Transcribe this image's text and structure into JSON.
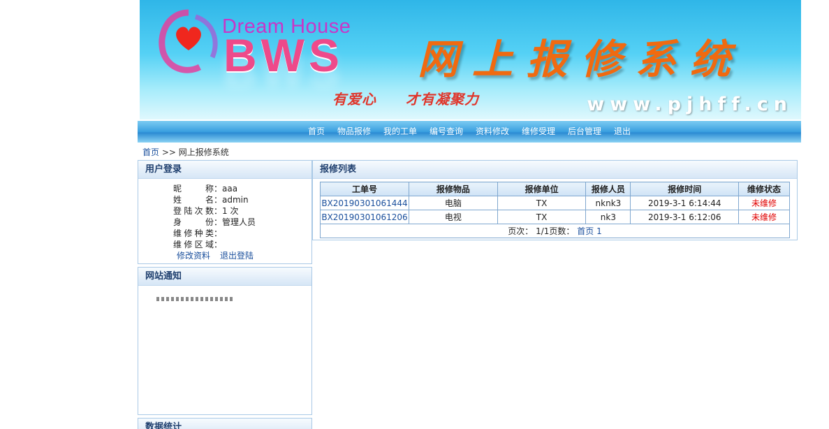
{
  "banner": {
    "brand_subtitle": "Dream House",
    "brand_main": "BWS",
    "system_title": "网上报修系统",
    "slogan": "有爱心 才有凝聚力",
    "site_url": "www.pjhff.cn"
  },
  "nav": {
    "items": [
      "首页",
      "物品报修",
      "我的工单",
      "编号查询",
      "资料修改",
      "维修受理",
      "后台管理",
      "退出"
    ]
  },
  "breadcrumb": {
    "home": "首页",
    "separator": ">>",
    "current": "网上报修系统"
  },
  "login_panel": {
    "title": "用户登录",
    "fields": [
      {
        "label": "昵称",
        "value": "aaa"
      },
      {
        "label": "姓名",
        "value": "admin"
      },
      {
        "label": "登陆次数",
        "value": "1 次"
      },
      {
        "label": "身份",
        "value": "管理人员"
      },
      {
        "label": "维修种类",
        "value": ""
      },
      {
        "label": "维修区域",
        "value": ""
      }
    ],
    "link_edit": "修改资料",
    "link_logout": "退出登陆"
  },
  "notice_panel": {
    "title": "网站通知"
  },
  "stats_panel": {
    "title": "数据统计"
  },
  "repair_list": {
    "title": "报修列表",
    "columns": [
      "工单号",
      "报修物品",
      "报修单位",
      "报修人员",
      "报修时间",
      "维修状态"
    ],
    "rows": [
      {
        "id": "BX20190301061444",
        "item": "电脑",
        "unit": "TX",
        "person": "nknk3",
        "time": "2019-3-1 6:14:44",
        "status": "未维修"
      },
      {
        "id": "BX20190301061206",
        "item": "电视",
        "unit": "TX",
        "person": "nk3",
        "time": "2019-3-1 6:12:06",
        "status": "未维修"
      }
    ],
    "pager_prefix": "页次：",
    "pager_pages": "1/1页数：",
    "pager_first": "首页",
    "pager_number": "1"
  },
  "colors": {
    "banner_top": "#2fb6e8",
    "nav_blue": "#3a9fe0",
    "title_orange": "#f06a10",
    "status_red": "#e00000",
    "link_blue": "#1a4f9c",
    "panel_border": "#a9c9e6"
  }
}
